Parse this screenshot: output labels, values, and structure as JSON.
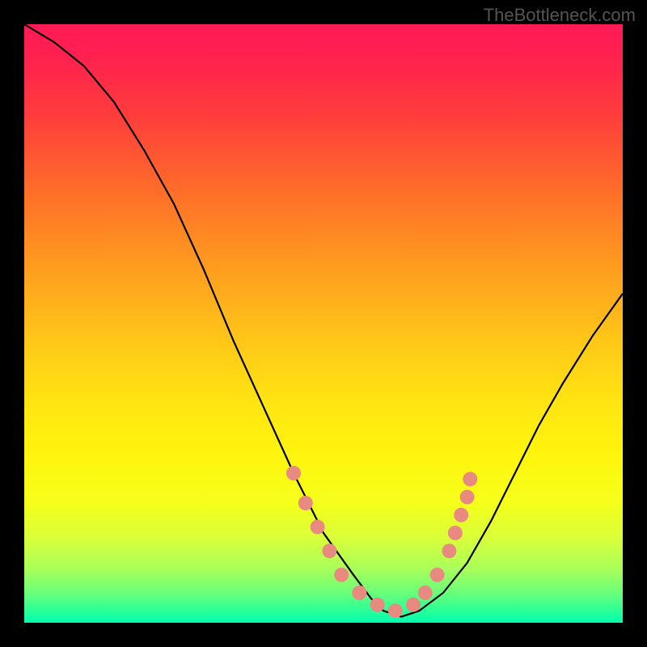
{
  "watermark": "TheBottleneck.com",
  "chart_data": {
    "type": "line",
    "title": "",
    "xlabel": "",
    "ylabel": "",
    "xlim": [
      0,
      100
    ],
    "ylim": [
      0,
      100
    ],
    "series": [
      {
        "name": "bottleneck-curve",
        "x": [
          0,
          5,
          10,
          15,
          20,
          25,
          30,
          35,
          40,
          45,
          50,
          55,
          58,
          60,
          63,
          66,
          70,
          74,
          78,
          82,
          86,
          90,
          95,
          100
        ],
        "y": [
          100,
          97,
          93,
          87,
          79,
          70,
          59,
          47,
          36,
          25,
          15,
          8,
          4,
          2,
          1,
          2,
          5,
          10,
          17,
          25,
          33,
          40,
          48,
          55
        ]
      }
    ],
    "markers": {
      "name": "highlight-points",
      "color": "#e88a80",
      "x": [
        45,
        47,
        49,
        51,
        53,
        56,
        59,
        62,
        65,
        67,
        69,
        71,
        72,
        73,
        74,
        74.5
      ],
      "y": [
        25,
        20,
        16,
        12,
        8,
        5,
        3,
        2,
        3,
        5,
        8,
        12,
        15,
        18,
        21,
        24
      ]
    }
  }
}
